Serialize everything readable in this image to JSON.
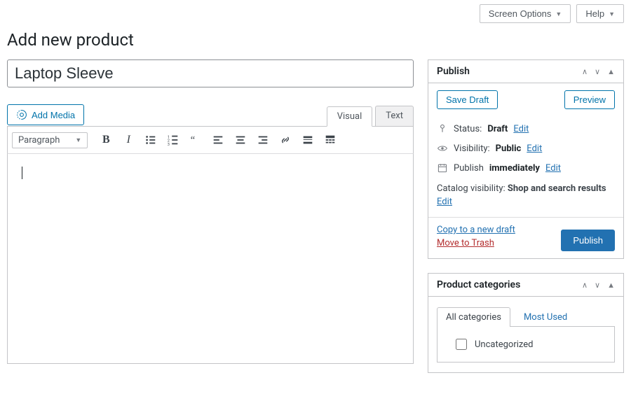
{
  "top": {
    "screen_options": "Screen Options",
    "help": "Help"
  },
  "page_title": "Add new product",
  "product_title": "Laptop Sleeve",
  "add_media": "Add Media",
  "editor": {
    "tab_visual": "Visual",
    "tab_text": "Text",
    "format_label": "Paragraph"
  },
  "publish": {
    "heading": "Publish",
    "save_draft": "Save Draft",
    "preview": "Preview",
    "status_label": "Status:",
    "status_value": "Draft",
    "visibility_label": "Visibility:",
    "visibility_value": "Public",
    "schedule_label": "Publish",
    "schedule_value": "immediately",
    "edit": "Edit",
    "catalog_label": "Catalog visibility:",
    "catalog_value": "Shop and search results",
    "copy_draft": "Copy to a new draft",
    "move_trash": "Move to Trash",
    "publish_btn": "Publish"
  },
  "categories": {
    "heading": "Product categories",
    "tab_all": "All categories",
    "tab_most": "Most Used",
    "items": [
      {
        "label": "Uncategorized",
        "checked": false
      }
    ]
  }
}
